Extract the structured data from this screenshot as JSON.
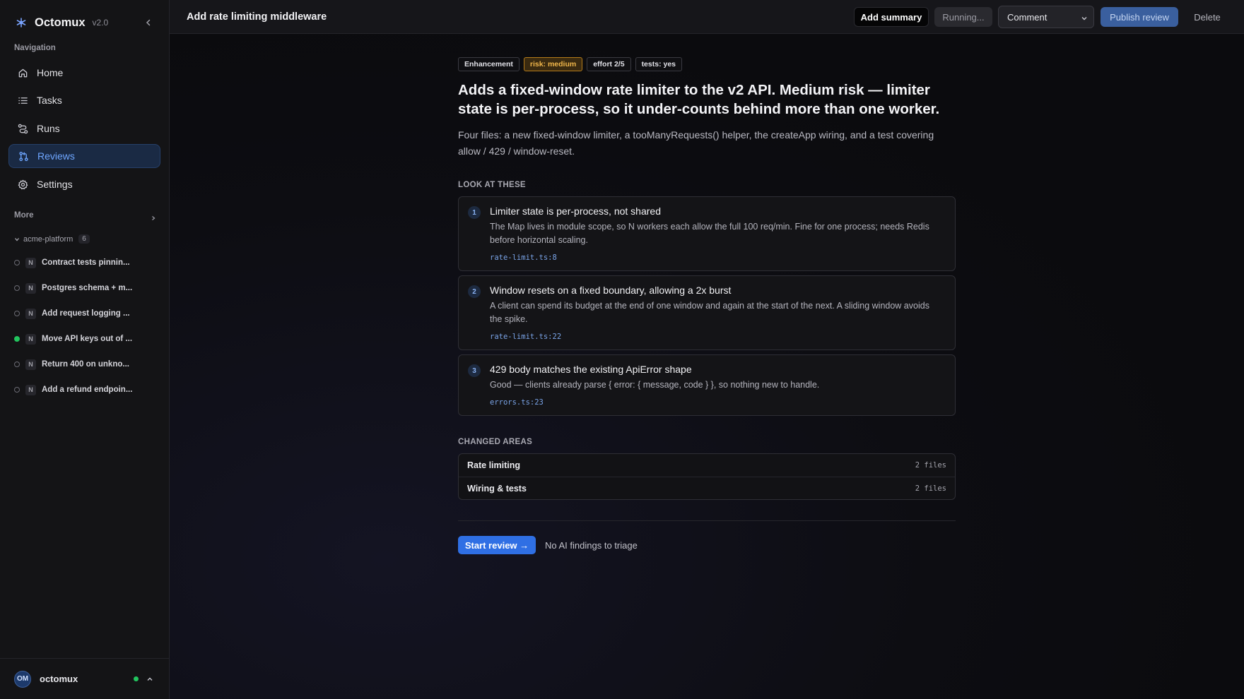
{
  "app": {
    "name": "Octomux",
    "version": "v2.0"
  },
  "sidebar": {
    "nav_label": "Navigation",
    "items": [
      {
        "label": "Home",
        "icon": "home-icon"
      },
      {
        "label": "Tasks",
        "icon": "list-icon"
      },
      {
        "label": "Runs",
        "icon": "flow-icon"
      },
      {
        "label": "Reviews",
        "icon": "git-pull-request-icon",
        "active": true
      },
      {
        "label": "Settings",
        "icon": "gear-icon"
      }
    ],
    "more_label": "More",
    "project": {
      "name": "acme-platform",
      "count": "6"
    },
    "tasks": [
      {
        "badge": "N",
        "title": "Contract tests pinnin...",
        "status": "idle"
      },
      {
        "badge": "N",
        "title": "Postgres schema + m...",
        "status": "idle"
      },
      {
        "badge": "N",
        "title": "Add request logging ...",
        "status": "idle"
      },
      {
        "badge": "N",
        "title": "Move API keys out of ...",
        "status": "active"
      },
      {
        "badge": "N",
        "title": "Return 400 on unkno...",
        "status": "idle"
      },
      {
        "badge": "N",
        "title": "Add a refund endpoin...",
        "status": "idle"
      }
    ],
    "user": {
      "initials": "OM",
      "name": "octomux"
    }
  },
  "header": {
    "title": "Add rate limiting middleware",
    "add_summary": "Add summary",
    "running": "Running...",
    "comment_select": "Comment",
    "publish": "Publish review",
    "delete": "Delete"
  },
  "review": {
    "chips": [
      "Enhancement",
      "risk: medium",
      "effort 2/5",
      "tests: yes"
    ],
    "headline": "Adds a fixed-window rate limiter to the v2 API. Medium risk — limiter state is per-process, so it under-counts behind more than one worker.",
    "summary": "Four files: a new fixed-window limiter, a tooManyRequests() helper, the createApp wiring, and a test covering allow / 429 / window-reset.",
    "look_label": "LOOK AT THESE",
    "findings": [
      {
        "num": "1",
        "title": "Limiter state is per-process, not shared",
        "body": "The Map lives in module scope, so N workers each allow the full 100 req/min. Fine for one process; needs Redis before horizontal scaling.",
        "file": "rate-limit.ts:8"
      },
      {
        "num": "2",
        "title": "Window resets on a fixed boundary, allowing a 2x burst",
        "body": "A client can spend its budget at the end of one window and again at the start of the next. A sliding window avoids the spike.",
        "file": "rate-limit.ts:22"
      },
      {
        "num": "3",
        "title": "429 body matches the existing ApiError shape",
        "body": "Good — clients already parse { error: { message, code } }, so nothing new to handle.",
        "file": "errors.ts:23"
      }
    ],
    "areas_label": "CHANGED AREAS",
    "areas": [
      {
        "name": "Rate limiting",
        "count": "2 files"
      },
      {
        "name": "Wiring & tests",
        "count": "2 files"
      }
    ],
    "start_review": "Start review →",
    "no_findings": "No AI findings to triage"
  }
}
